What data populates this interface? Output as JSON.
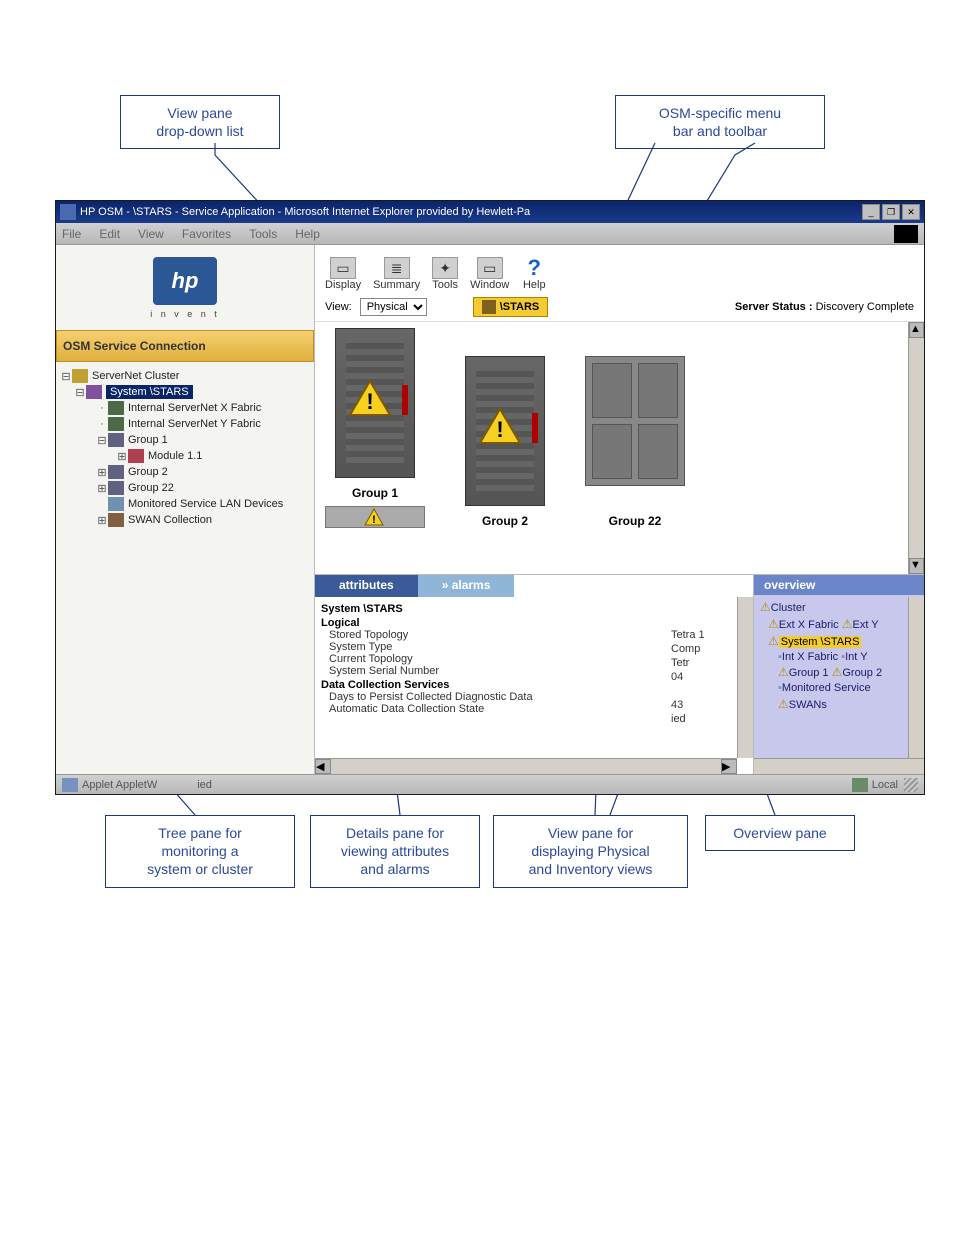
{
  "callouts": {
    "view_pane_dd": "View pane\ndrop-down list",
    "osm_toolbar": "OSM-specific menu\nbar and toolbar",
    "tree_pane": "Tree pane for\nmonitoring a\nsystem or cluster",
    "details_pane": "Details pane for\nviewing attributes\nand alarms",
    "view_pane": "View pane for\ndisplaying Physical\nand Inventory views",
    "overview_pane": "Overview pane"
  },
  "titlebar": {
    "text": "HP OSM - \\STARS - Service Application - Microsoft Internet Explorer provided by Hewlett-Pa"
  },
  "win_buttons": {
    "min": "_",
    "max": "❐",
    "close": "✕"
  },
  "menubar": {
    "items": [
      "File",
      "Edit",
      "View",
      "Favorites",
      "Tools",
      "Help"
    ]
  },
  "logo": {
    "text": "hp",
    "tag": "i n v e n t"
  },
  "osm_header": "OSM Service Connection",
  "tree": {
    "n0": "ServerNet Cluster",
    "n1": "System \\STARS",
    "n2": "Internal ServerNet X Fabric",
    "n3": "Internal ServerNet Y Fabric",
    "n4": "Group 1",
    "n5": "Module 1.1",
    "n6": "Group 2",
    "n7": "Group 22",
    "n8": "Monitored Service LAN Devices",
    "n9": "SWAN Collection"
  },
  "toolbar": {
    "display": "Display",
    "summary": "Summary",
    "tools": "Tools",
    "window": "Window",
    "help": "Help"
  },
  "view_row": {
    "label": "View:",
    "selected": "Physical",
    "badge": "\\STARS",
    "status_label": "Server Status :",
    "status_value": "Discovery Complete"
  },
  "racks": {
    "g1": "Group 1",
    "g2": "Group 2",
    "g22": "Group 22"
  },
  "tabs": {
    "attributes": "attributes",
    "alarms": "» alarms",
    "overview": "overview"
  },
  "details": {
    "h1": "System \\STARS",
    "h2": "Logical",
    "r1": "Stored Topology",
    "r2": "System Type",
    "r3": "Current Topology",
    "r4": "System Serial Number",
    "h3": "Data Collection Services",
    "r5": "Days to Persist Collected Diagnostic Data",
    "r6": "Automatic Data Collection State",
    "v1": "Tetra 1",
    "v2": "Comp",
    "v3": "Tetr",
    "v4": "04",
    "v5": "43",
    "v6": "ied"
  },
  "overview": {
    "l1": "Cluster",
    "l2a": "Ext X Fabric",
    "l2b": "Ext Y",
    "l3": "System \\STARS",
    "l4a": "Int X Fabric",
    "l4b": "Int Y",
    "l5a": "Group 1",
    "l5b": "Group 2",
    "l6": "Monitored Service",
    "l7": "SWANs"
  },
  "statusbar": {
    "left": "Applet AppletW",
    "left2": "ied",
    "right": "Local"
  }
}
